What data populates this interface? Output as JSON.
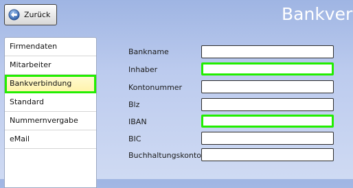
{
  "toolbar": {
    "back_label": "Zurück",
    "back_icon": "arrow-left-circle-icon"
  },
  "page": {
    "title": "Bankverbi"
  },
  "sidebar": {
    "items": [
      {
        "label": "Firmendaten"
      },
      {
        "label": "Mitarbeiter"
      },
      {
        "label": "Bankverbindung",
        "selected": true
      },
      {
        "label": "Standard"
      },
      {
        "label": "Nummernvergabe"
      },
      {
        "label": "eMail"
      }
    ]
  },
  "form": {
    "fields": [
      {
        "label": "Bankname",
        "value": ""
      },
      {
        "label": "Inhaber",
        "value": "",
        "highlighted": true
      },
      {
        "label": "Kontonummer",
        "value": ""
      },
      {
        "label": "Blz",
        "value": ""
      },
      {
        "label": "IBAN",
        "value": "",
        "highlighted": true
      },
      {
        "label": "BIC",
        "value": ""
      },
      {
        "label": "Buchhaltungskonto",
        "value": ""
      }
    ]
  },
  "colors": {
    "highlight": "#22ee00",
    "selected_item": "#fff2a8",
    "background_top": "#9fb5e3",
    "background_bottom": "#cfdaf3"
  }
}
